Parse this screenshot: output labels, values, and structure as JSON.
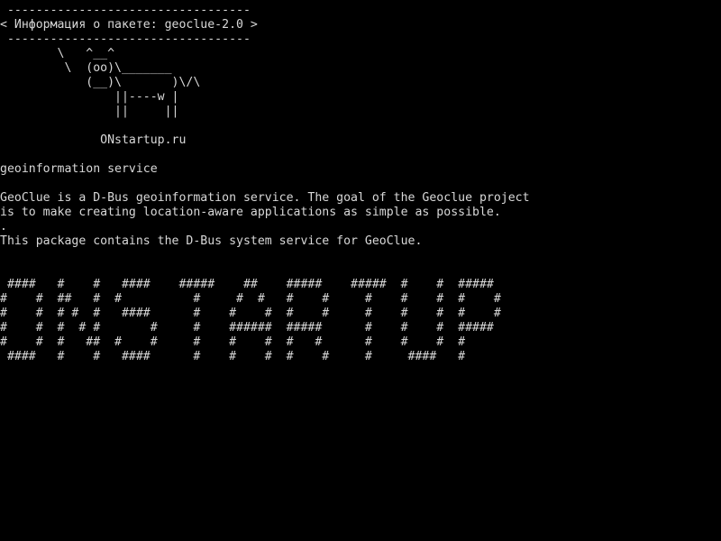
{
  "terminal": {
    "theme": {
      "background": "#000000",
      "foreground": "#d8d8d8"
    },
    "cowsay": [
      " ----------------------------------",
      "< Информация о пакете: geoclue-2.0 >",
      " ----------------------------------",
      "        \\   ^__^",
      "         \\  (oo)\\_______",
      "            (__)\\       )\\/\\",
      "                ||----w |",
      "                ||     ||",
      "",
      "              ONstartup.ru"
    ],
    "summary": "geoinformation service",
    "description": [
      "GeoClue is a D-Bus geoinformation service. The goal of the Geoclue project",
      "is to make creating location-aware applications as simple as possible.",
      ".",
      "This package contains the D-Bus system service for GeoClue."
    ],
    "banner": [
      " ####   #    #   ####    #####    ##    #####    #####  #    #  #####",
      "#    #  ##   #  #          #     #  #   #    #     #    #    #  #    #",
      "#    #  # #  #   ####      #    #    #  #    #     #    #    #  #    #",
      "#    #  #  # #       #     #    ######  #####      #    #    #  #####",
      "#    #  #   ##  #    #     #    #    #  #   #      #    #    #  #",
      " ####   #    #   ####      #    #    #  #    #     #     ####   #"
    ]
  }
}
